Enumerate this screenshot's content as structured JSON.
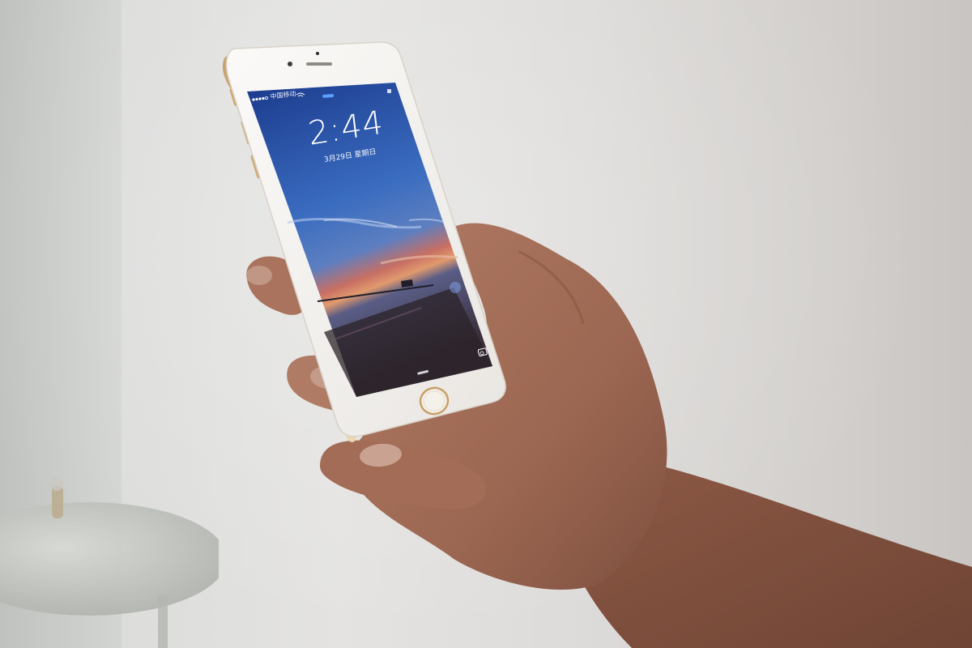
{
  "scene": {
    "description_colors": {
      "wall": "#e2e1df",
      "phone_body": "#f2f1ef",
      "phone_gold": "#d8b98a",
      "sky_top": "#1f3f8f",
      "sky_bottom": "#3a6fc0",
      "sunset": "#d97a5a",
      "skin": "#9a6650"
    }
  },
  "lockscreen": {
    "carrier": "中国移动",
    "time": "2:44",
    "date": "3月29日 星期日"
  },
  "icons": {
    "signal": "signal-dots-icon",
    "wifi": "wifi-icon",
    "lock": "lock-icon",
    "camera": "camera-icon",
    "home_button": "home-button-icon"
  }
}
